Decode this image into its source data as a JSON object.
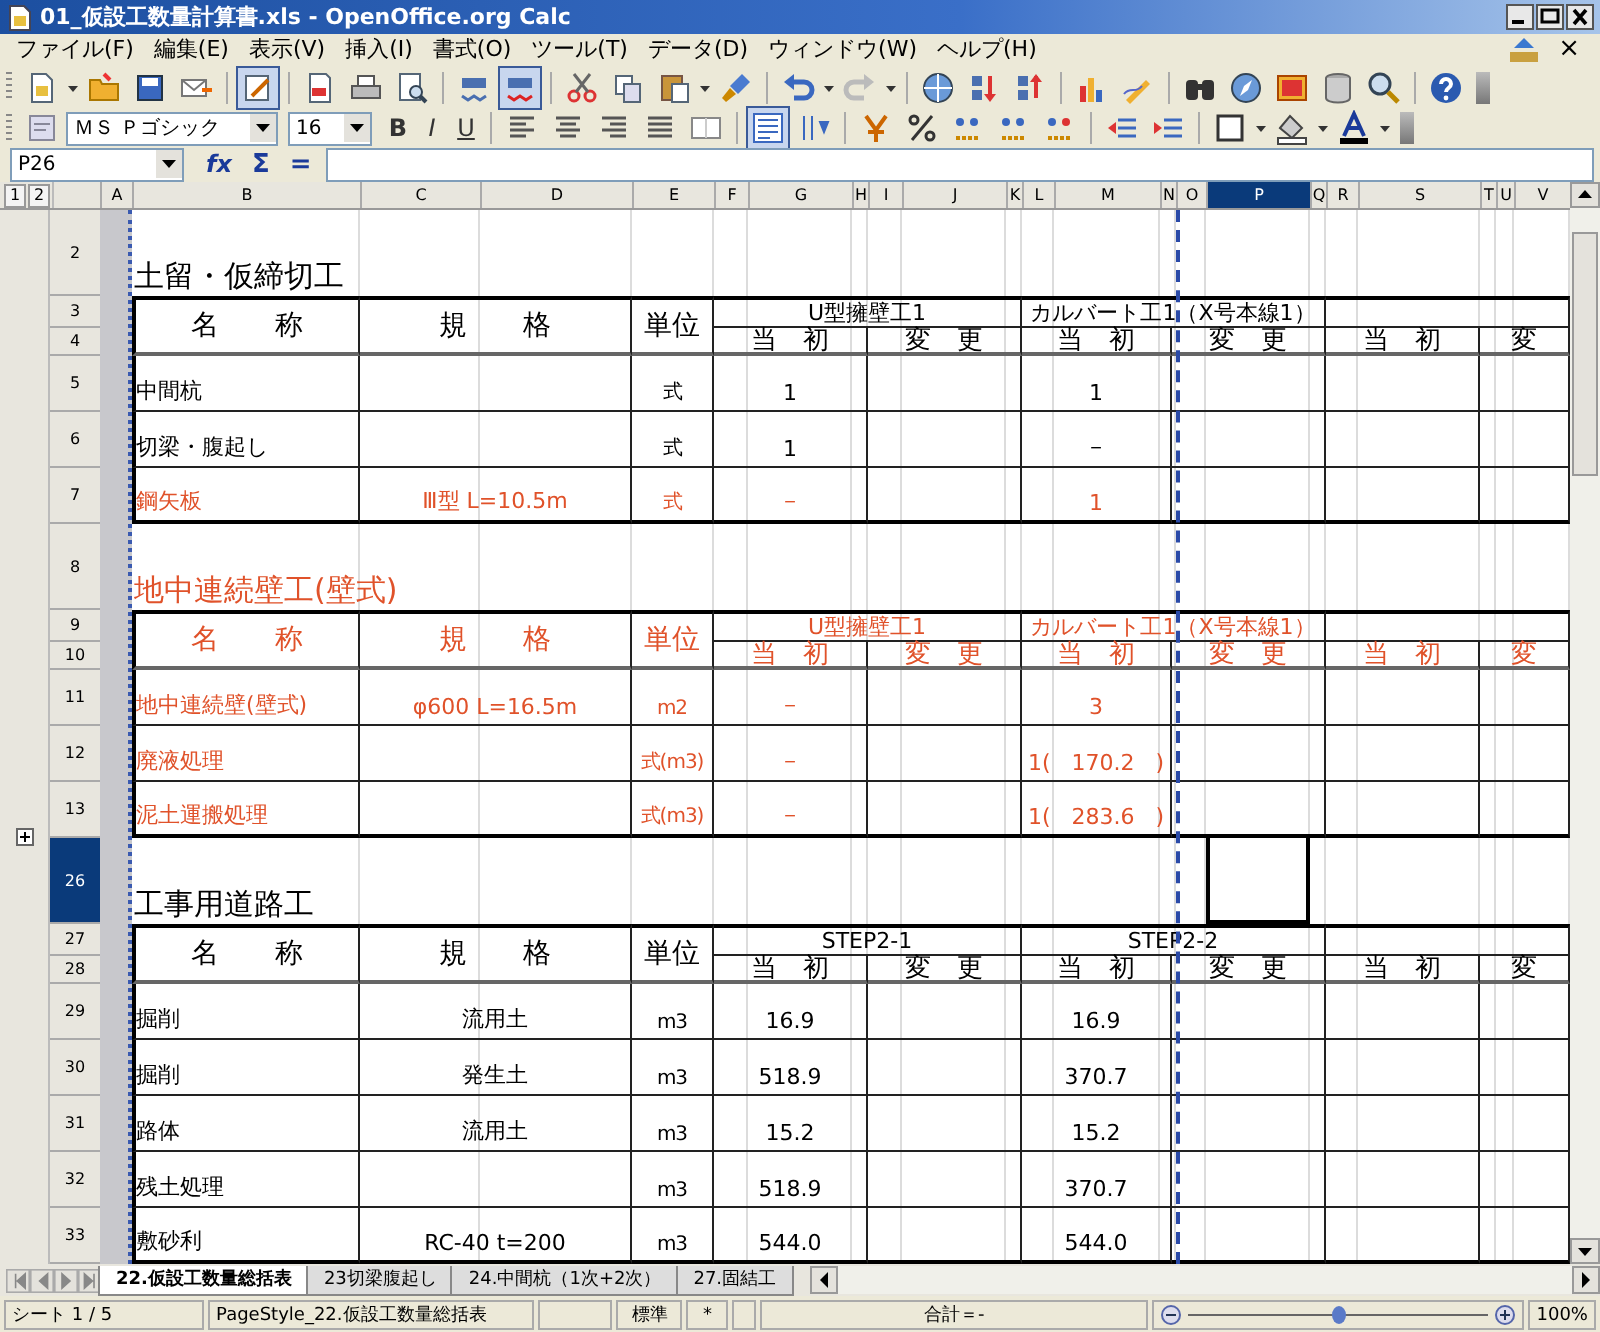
{
  "window": {
    "title": "01_仮設工数量計算書.xls - OpenOffice.org Calc"
  },
  "menu": [
    {
      "label": "ファイル(F)"
    },
    {
      "label": "編集(E)"
    },
    {
      "label": "表示(V)"
    },
    {
      "label": "挿入(I)"
    },
    {
      "label": "書式(O)"
    },
    {
      "label": "ツール(T)"
    },
    {
      "label": "データ(D)"
    },
    {
      "label": "ウィンドウ(W)"
    },
    {
      "label": "ヘルプ(H)"
    }
  ],
  "document_close": "×",
  "toolbars": {
    "edit_mode_on": true,
    "auto_spellcheck_on": true,
    "wrap_text_on": true
  },
  "formatting": {
    "font_name": "ＭＳ Ｐゴシック",
    "font_size": "16",
    "bold": "B",
    "italic": "I",
    "underline": "U"
  },
  "formula_bar": {
    "cell_reference": "P26",
    "function_wizard": "fx",
    "sum": "Σ",
    "equals": "="
  },
  "sheet": {
    "outline_levels": [
      "1",
      "2"
    ],
    "columns": [
      {
        "label": "A",
        "selected": false
      },
      {
        "label": "B",
        "selected": false
      },
      {
        "label": "C",
        "selected": false
      },
      {
        "label": "D",
        "selected": false
      },
      {
        "label": "E",
        "selected": false
      },
      {
        "label": "F",
        "selected": false
      },
      {
        "label": "G",
        "selected": false
      },
      {
        "label": "H",
        "selected": false
      },
      {
        "label": "I",
        "selected": false
      },
      {
        "label": "J",
        "selected": false
      },
      {
        "label": "K",
        "selected": false
      },
      {
        "label": "L",
        "selected": false
      },
      {
        "label": "M",
        "selected": false
      },
      {
        "label": "N",
        "selected": false
      },
      {
        "label": "O",
        "selected": false
      },
      {
        "label": "P",
        "selected": true
      },
      {
        "label": "Q",
        "selected": false
      },
      {
        "label": "R",
        "selected": false
      },
      {
        "label": "S",
        "selected": false
      },
      {
        "label": "T",
        "selected": false
      },
      {
        "label": "U",
        "selected": false
      },
      {
        "label": "V",
        "selected": false
      }
    ],
    "row_headers": [
      {
        "label": "2",
        "selected": false
      },
      {
        "label": "3",
        "selected": false
      },
      {
        "label": "4",
        "selected": false
      },
      {
        "label": "5",
        "selected": false
      },
      {
        "label": "6",
        "selected": false
      },
      {
        "label": "7",
        "selected": false
      },
      {
        "label": "8",
        "selected": false
      },
      {
        "label": "9",
        "selected": false
      },
      {
        "label": "10",
        "selected": false
      },
      {
        "label": "11",
        "selected": false
      },
      {
        "label": "12",
        "selected": false
      },
      {
        "label": "13",
        "selected": false
      },
      {
        "label": "26",
        "selected": true
      },
      {
        "label": "27",
        "selected": false
      },
      {
        "label": "28",
        "selected": false
      },
      {
        "label": "29",
        "selected": false
      },
      {
        "label": "30",
        "selected": false
      },
      {
        "label": "31",
        "selected": false
      },
      {
        "label": "32",
        "selected": false
      },
      {
        "label": "33",
        "selected": false
      }
    ],
    "sections": [
      {
        "title": "土留・仮締切工",
        "color": "#000000",
        "headers": [
          "名　　称",
          "規　　格",
          "単位"
        ],
        "groups": [
          "U型擁壁工1",
          "カルバート工1（X号本線1）"
        ],
        "subheaders": [
          "当　初",
          "変　更",
          "当　初",
          "変　更",
          "当　初",
          "変"
        ],
        "rows": [
          {
            "name": "中間杭",
            "unit": "式",
            "values": [
              "1",
              "1"
            ],
            "color": "#000000"
          },
          {
            "name": "切梁・腹起し",
            "unit": "式",
            "values": [
              "1",
              "－"
            ],
            "color": "#000000"
          },
          {
            "name": "鋼矢板",
            "spec": "Ⅲ型 L=10.5m",
            "unit": "式",
            "values": [
              "－",
              "1"
            ],
            "color": "#e0522a"
          }
        ]
      },
      {
        "title": "地中連続壁工(壁式)",
        "color": "#e0522a",
        "headers": [
          "名　　称",
          "規　　格",
          "単位"
        ],
        "groups": [
          "U型擁壁工1",
          "カルバート工1（X号本線1）"
        ],
        "subheaders": [
          "当　初",
          "変　更",
          "当　初",
          "変　更",
          "当　初",
          "変"
        ],
        "rows": [
          {
            "name": "地中連続壁(壁式)",
            "spec": "φ600 L=16.5m",
            "unit": "m2",
            "values": [
              "－",
              "3"
            ],
            "color": "#e0522a"
          },
          {
            "name": "廃液処理",
            "unit": "式(m3)",
            "values": [
              "－",
              "1(   170.2   )"
            ],
            "color": "#e0522a"
          },
          {
            "name": "泥土運搬処理",
            "unit": "式(m3)",
            "values": [
              "－",
              "1(   283.6   )"
            ],
            "color": "#e0522a"
          }
        ]
      },
      {
        "title": "工事用道路工",
        "color": "#000000",
        "headers": [
          "名　　称",
          "規　　格",
          "単位"
        ],
        "groups": [
          "STEP2-1",
          "STEP2-2"
        ],
        "subheaders": [
          "当　初",
          "変　更",
          "当　初",
          "変　更",
          "当　初",
          "変"
        ],
        "rows": [
          {
            "name": "掘削",
            "spec": "流用土",
            "unit": "m3",
            "values": [
              "16.9",
              "16.9"
            ],
            "color": "#000000"
          },
          {
            "name": "掘削",
            "spec": "発生土",
            "unit": "m3",
            "values": [
              "518.9",
              "370.7"
            ],
            "color": "#000000"
          },
          {
            "name": "路体",
            "spec": "流用土",
            "unit": "m3",
            "values": [
              "15.2",
              "15.2"
            ],
            "color": "#000000"
          },
          {
            "name": "残土処理",
            "unit": "m3",
            "values": [
              "518.9",
              "370.7"
            ],
            "color": "#000000"
          },
          {
            "name": "敷砂利",
            "spec": "RC-40 t=200",
            "unit": "m3",
            "values": [
              "544.0",
              "544.0"
            ],
            "color": "#000000"
          }
        ]
      }
    ]
  },
  "sheet_tabs": [
    {
      "label": "22.仮設工数量総括表",
      "selected": true
    },
    {
      "label": "23切梁腹起し",
      "selected": false
    },
    {
      "label": "24.中間杭（1次+2次）",
      "selected": false
    },
    {
      "label": "27.固結工",
      "selected": false
    }
  ],
  "status_bar": {
    "sheet": "シート 1 / 5",
    "page_style": "PageStyle_22.仮設工数量総括表",
    "mode": "標準",
    "modified": "*",
    "sum": "合計＝-",
    "zoom": {
      "level": 0.5,
      "reading": "100%"
    }
  }
}
